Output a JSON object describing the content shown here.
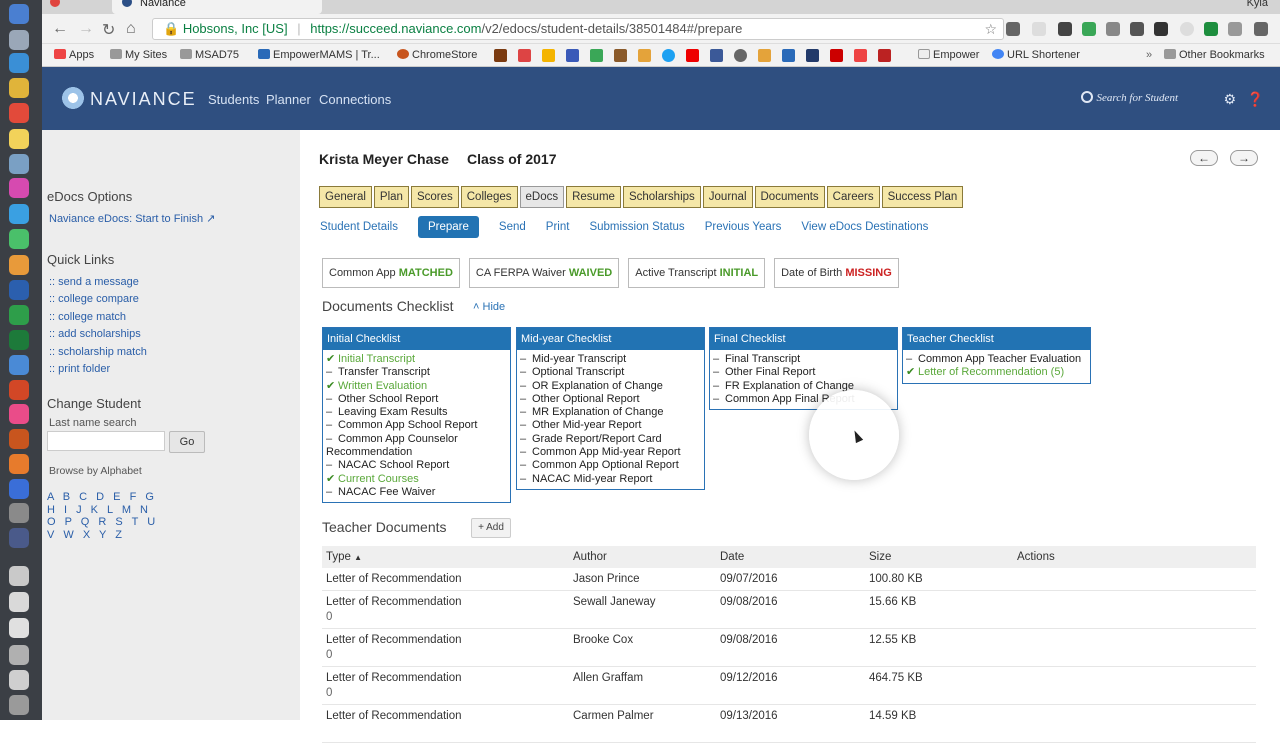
{
  "browser": {
    "tab_title": "Naviance",
    "user_label": "Kyla",
    "secure_label": "Hobsons, Inc [US]",
    "url_host": "https://succeed.naviance.com",
    "url_path": "/v2/edocs/student-details/38501484#/prepare",
    "bookmarks": [
      {
        "label": "Apps",
        "icon": "apps-grid-icon"
      },
      {
        "label": "My Sites",
        "icon": "folder-icon"
      },
      {
        "label": "MSAD75",
        "icon": "folder-icon"
      },
      {
        "label": "EmpowerMAMS | Tr...",
        "icon": "trello-icon"
      },
      {
        "label": "ChromeStore",
        "icon": "chrome-store-icon"
      },
      {
        "label": "Empower",
        "icon": "page-icon"
      },
      {
        "label": "URL Shortener",
        "icon": "google-icon"
      },
      {
        "label": "Other Bookmarks",
        "icon": "folder-icon"
      }
    ]
  },
  "header": {
    "brand": "NAVIANCE",
    "nav": [
      "Students",
      "Planner",
      "Connections"
    ],
    "search_label": "Search for Student",
    "accent": "#2f4f80"
  },
  "sidebar": {
    "edocs_options_title": "eDocs Options",
    "edocs_link": "Naviance eDocs: Start to Finish",
    "quick_links_title": "Quick Links",
    "quick_links": [
      ":: send a message",
      ":: college compare",
      ":: college match",
      ":: add scholarships",
      ":: scholarship match",
      ":: print folder"
    ],
    "change_student_title": "Change Student",
    "last_name_label": "Last name search",
    "go_label": "Go",
    "browse_label": "Browse by Alphabet",
    "alphabet": "A B C D E F G H I J K L M N O P Q R S T U V W X Y Z"
  },
  "student": {
    "name": "Krista Meyer Chase",
    "class": "Class of 2017"
  },
  "tabs": [
    "General",
    "Plan",
    "Scores",
    "Colleges",
    "eDocs",
    "Resume",
    "Scholarships",
    "Journal",
    "Documents",
    "Careers",
    "Success Plan"
  ],
  "active_tab": "eDocs",
  "subnav": [
    "Student Details",
    "Prepare",
    "Send",
    "Print",
    "Submission Status",
    "Previous Years",
    "View eDocs Destinations"
  ],
  "active_subnav": "Prepare",
  "status": [
    {
      "label": "Common App",
      "value": "MATCHED",
      "state": "ok"
    },
    {
      "label": "CA FERPA Waiver",
      "value": "WAIVED",
      "state": "ok"
    },
    {
      "label": "Active Transcript",
      "value": "INITIAL",
      "state": "ok"
    },
    {
      "label": "Date of Birth",
      "value": "MISSING",
      "state": "bad"
    }
  ],
  "documents_checklist": {
    "title": "Documents Checklist",
    "hide_label": "Hide",
    "lists": [
      {
        "title": "Initial Checklist",
        "items": [
          {
            "label": "Initial Transcript",
            "done": true
          },
          {
            "label": "Transfer Transcript",
            "done": false
          },
          {
            "label": "Written Evaluation",
            "done": true
          },
          {
            "label": "Other School Report",
            "done": false
          },
          {
            "label": "Leaving Exam Results",
            "done": false
          },
          {
            "label": "Common App School Report",
            "done": false
          },
          {
            "label": "Common App Counselor Recommendation",
            "done": false
          },
          {
            "label": "NACAC School Report",
            "done": false
          },
          {
            "label": "Current Courses",
            "done": true
          },
          {
            "label": "NACAC Fee Waiver",
            "done": false
          }
        ]
      },
      {
        "title": "Mid-year Checklist",
        "items": [
          {
            "label": "Mid-year Transcript",
            "done": false
          },
          {
            "label": "Optional Transcript",
            "done": false
          },
          {
            "label": "OR Explanation of Change",
            "done": false
          },
          {
            "label": "Other Optional Report",
            "done": false
          },
          {
            "label": "MR Explanation of Change",
            "done": false
          },
          {
            "label": "Other Mid-year Report",
            "done": false
          },
          {
            "label": "Grade Report/Report Card",
            "done": false
          },
          {
            "label": "Common App Mid-year Report",
            "done": false
          },
          {
            "label": "Common App Optional Report",
            "done": false
          },
          {
            "label": "NACAC Mid-year Report",
            "done": false
          }
        ]
      },
      {
        "title": "Final Checklist",
        "items": [
          {
            "label": "Final Transcript",
            "done": false
          },
          {
            "label": "Other Final Report",
            "done": false
          },
          {
            "label": "FR Explanation of Change",
            "done": false
          },
          {
            "label": "Common App Final Report",
            "done": false
          }
        ]
      },
      {
        "title": "Teacher Checklist",
        "items": [
          {
            "label": "Common App Teacher Evaluation",
            "done": false
          },
          {
            "label": "Letter of Recommendation  (5)",
            "done": true
          }
        ]
      }
    ]
  },
  "teacher_documents": {
    "title": "Teacher Documents",
    "add_label": "+ Add",
    "columns": [
      "Type",
      "Author",
      "Date",
      "Size",
      "Actions"
    ],
    "rows": [
      {
        "type": "Letter of Recommendation",
        "author": "Jason Prince",
        "date": "09/07/2016",
        "size": "100.80 KB",
        "extra": ""
      },
      {
        "type": "Letter of Recommendation",
        "author": "Sewall Janeway",
        "date": "09/08/2016",
        "size": "15.66 KB",
        "extra": "0"
      },
      {
        "type": "Letter of Recommendation",
        "author": "Brooke Cox",
        "date": "09/08/2016",
        "size": "12.55 KB",
        "extra": "0"
      },
      {
        "type": "Letter of Recommendation",
        "author": "Allen Graffam",
        "date": "09/12/2016",
        "size": "464.75 KB",
        "extra": "0"
      },
      {
        "type": "Letter of Recommendation",
        "author": "Carmen Palmer",
        "date": "09/13/2016",
        "size": "14.59 KB",
        "extra": ""
      }
    ]
  }
}
